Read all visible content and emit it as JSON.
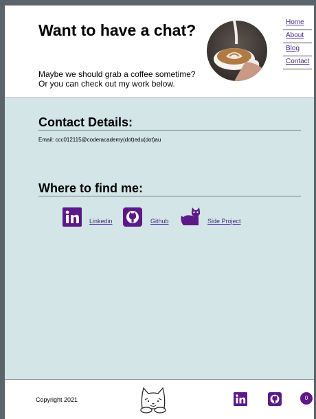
{
  "header": {
    "title": "Want to have a chat?",
    "subtitle_line1": "Maybe we should grab a coffee sometime?",
    "subtitle_line2": "Or you can check out my work below."
  },
  "nav": {
    "items": [
      {
        "label": "Home"
      },
      {
        "label": "About"
      },
      {
        "label": "Blog"
      },
      {
        "label": "Contact"
      }
    ]
  },
  "contact": {
    "title": "Contact Details:",
    "email_line": "Email: ccc012115@coderacademy(dot)edu(dot)au"
  },
  "find": {
    "title": "Where to find me:",
    "links": [
      {
        "label": "Linkedin",
        "icon": "linkedin-icon"
      },
      {
        "label": "Github",
        "icon": "github-icon"
      },
      {
        "label": "Side Project",
        "icon": "cat-icon"
      }
    ]
  },
  "footer": {
    "copyright": "Copyright 2021",
    "counter": "0"
  },
  "colors": {
    "accent": "#5c1a87",
    "link": "#4a2a8a",
    "section_bg": "#d3e5e6"
  }
}
